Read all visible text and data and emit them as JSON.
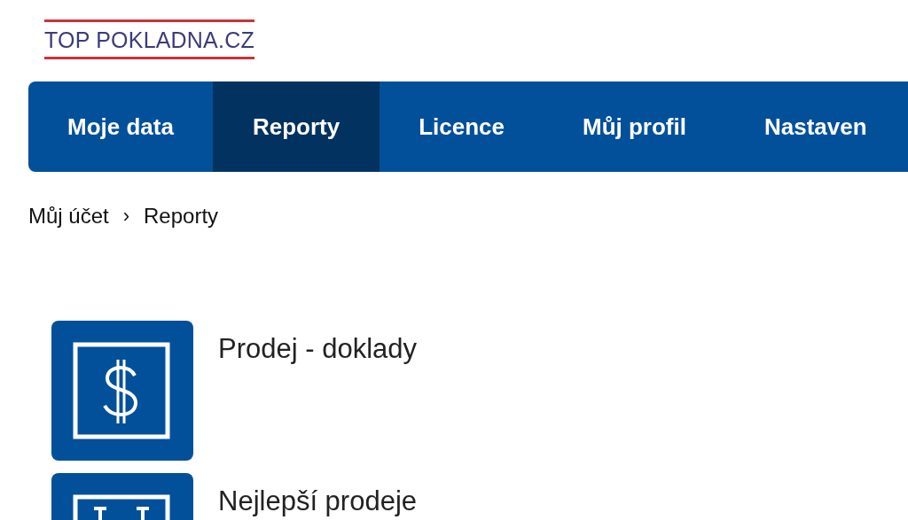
{
  "logo": {
    "text": "TOP POKLADNA.CZ"
  },
  "nav": {
    "tabs": [
      {
        "label": "Moje data",
        "selected": false
      },
      {
        "label": "Reporty",
        "selected": true
      },
      {
        "label": "Licence",
        "selected": false
      },
      {
        "label": "Můj profil",
        "selected": false
      },
      {
        "label": "Nastaven",
        "selected": false
      }
    ]
  },
  "breadcrumb": {
    "items": [
      "Můj účet",
      "Reporty"
    ],
    "separator": "›"
  },
  "reports": [
    {
      "kind": "money",
      "title": "Prodej - doklady"
    },
    {
      "kind": "bars",
      "title": "Nejlepší prodeje"
    }
  ]
}
